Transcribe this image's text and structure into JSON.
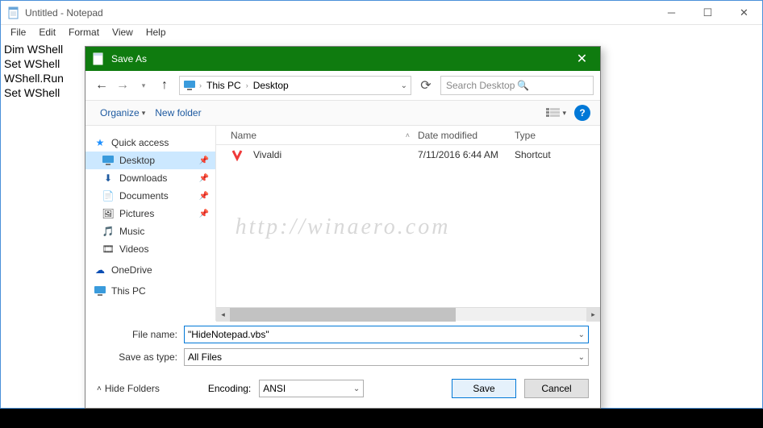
{
  "notepad": {
    "title": "Untitled - Notepad",
    "menu": {
      "file": "File",
      "edit": "Edit",
      "format": "Format",
      "view": "View",
      "help": "Help"
    },
    "lines": [
      "Dim WShell",
      "Set WShell",
      "WShell.Run",
      "Set WShell"
    ]
  },
  "saveas": {
    "title": "Save As",
    "nav": {
      "thispc": "This PC",
      "desktop": "Desktop"
    },
    "search_placeholder": "Search Desktop",
    "toolbar": {
      "organize": "Organize",
      "newfolder": "New folder"
    },
    "tree": {
      "quick": "Quick access",
      "desktop": "Desktop",
      "downloads": "Downloads",
      "documents": "Documents",
      "pictures": "Pictures",
      "music": "Music",
      "videos": "Videos",
      "onedrive": "OneDrive",
      "thispc": "This PC"
    },
    "columns": {
      "name": "Name",
      "date": "Date modified",
      "type": "Type"
    },
    "rows": [
      {
        "name": "Vivaldi",
        "date": "7/11/2016 6:44 AM",
        "type": "Shortcut"
      }
    ],
    "filename_label": "File name:",
    "filename_value": "\"HideNotepad.vbs\"",
    "saveastype_label": "Save as type:",
    "saveastype_value": "All Files",
    "hidefolders": "Hide Folders",
    "encoding_label": "Encoding:",
    "encoding_value": "ANSI",
    "save": "Save",
    "cancel": "Cancel"
  },
  "watermark": "http://winaero.com"
}
